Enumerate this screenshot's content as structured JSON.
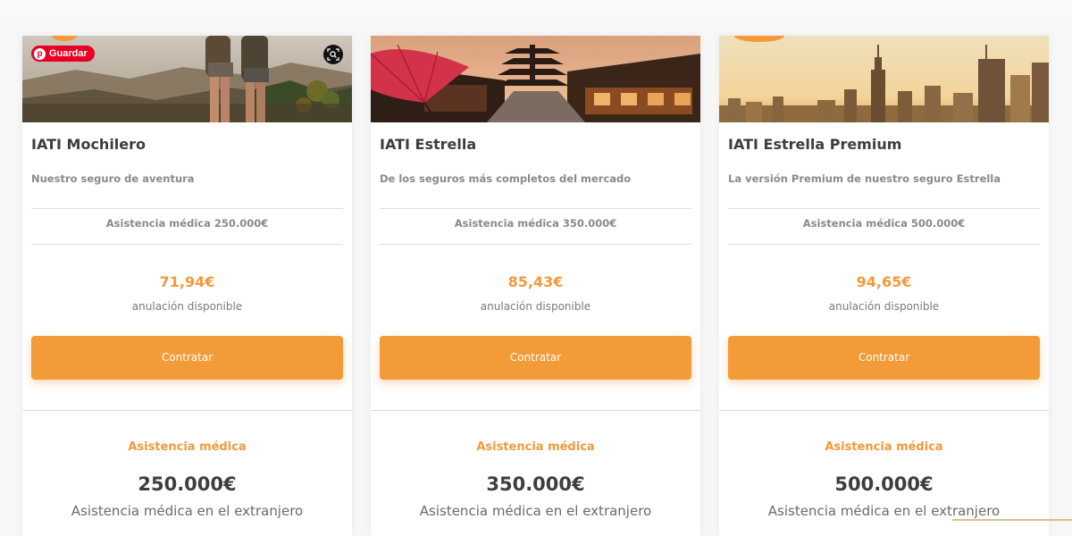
{
  "plans": [
    {
      "title": "IATI Mochilero",
      "subtitle": "Nuestro seguro de aventura",
      "coverage": "Asistencia médica 250.000€",
      "price": "71,94€",
      "cancel_note": "anulación disponible",
      "cta": "Contratar",
      "benefit_title": "Asistencia médica",
      "benefit_amount": "250.000€",
      "benefit_desc": "Asistencia médica en el extranjero",
      "image": "backpackers-mountain"
    },
    {
      "title": "IATI Estrella",
      "subtitle": "De los seguros más completos del mercado",
      "coverage": "Asistencia médica 350.000€",
      "price": "85,43€",
      "cancel_note": "anulación disponible",
      "cta": "Contratar",
      "benefit_title": "Asistencia médica",
      "benefit_amount": "350.000€",
      "benefit_desc": "Asistencia médica en el extranjero",
      "image": "kyoto-street-umbrella"
    },
    {
      "title": "IATI Estrella Premium",
      "subtitle": "La versión Premium de nuestro seguro Estrella",
      "coverage": "Asistencia médica 500.000€",
      "price": "94,65€",
      "cancel_note": "anulación disponible",
      "cta": "Contratar",
      "benefit_title": "Asistencia médica",
      "benefit_amount": "500.000€",
      "benefit_desc": "Asistencia médica en el extranjero",
      "image": "new-york-skyline"
    }
  ],
  "pinterest": {
    "save_label": "Guardar"
  },
  "colors": {
    "accent": "#f29b38",
    "price": "#f2993b",
    "pinterest": "#e60023"
  },
  "icons": {
    "pin": "pinterest-icon",
    "lens": "visual-search-icon"
  }
}
